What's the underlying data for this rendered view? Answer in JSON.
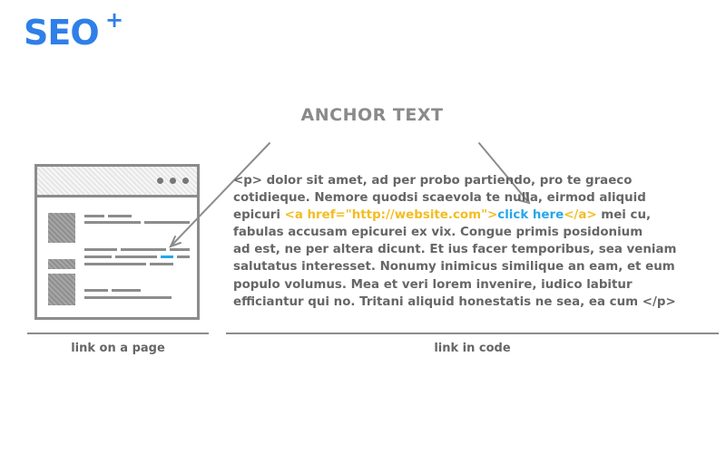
{
  "logo": {
    "text": "SEO",
    "plus": "+"
  },
  "title": "ANCHOR TEXT",
  "code_lines": [
    [
      "<p> dolor sit amet, ad per probo partiendo, pro te graeco"
    ],
    [
      "cotidieque. Nemore quodsi scaevola te nulla, eirmod aliquid"
    ],
    [
      "epicuri ",
      "<a href=\"http://website.com\">",
      "click here",
      "</a>",
      " mei cu,"
    ],
    [
      "fabulas accusam epicurei ex vix. Congue primis posidonium"
    ],
    [
      "ad est, ne per altera dicunt. Et ius facer temporibus, sea veniam"
    ],
    [
      "salutatus interesset. Nonumy inimicus similique an eam, et eum"
    ],
    [
      "populo volumus. Mea et veri lorem invenire, iudico labitur"
    ],
    [
      "efficiantur qui no. Tritani aliquid honestatis ne sea, ea cum </p>"
    ]
  ],
  "captions": {
    "left": "link on a page",
    "right": "link in code"
  },
  "colors": {
    "logo": "#2f7fe8",
    "tag": "#f3bd22",
    "link": "#25a7ea",
    "text": "#666666",
    "line": "#8c8c8c"
  }
}
